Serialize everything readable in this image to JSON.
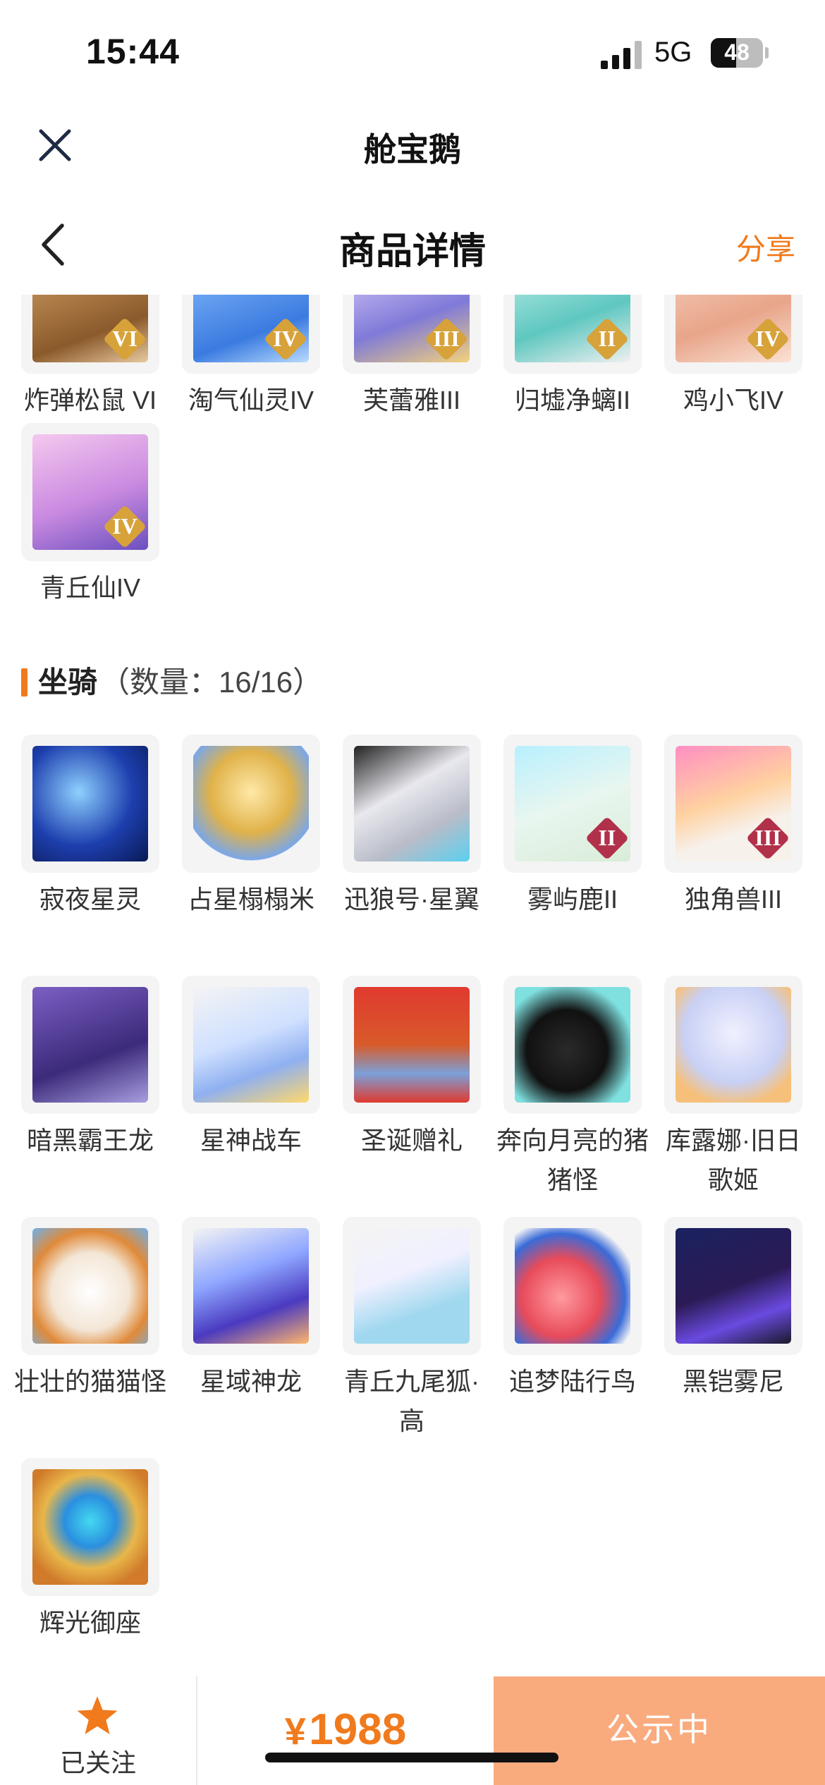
{
  "status_bar": {
    "time": "15:44",
    "network": "5G",
    "battery": 48
  },
  "header": {
    "app_title": "舱宝鹅",
    "page_title": "商品详情",
    "share_label": "分享"
  },
  "pets_partial": {
    "items": [
      {
        "name": "炸弹松鼠 VI",
        "rank": "VI"
      },
      {
        "name": "淘气仙灵IV",
        "rank": "IV"
      },
      {
        "name": "芙蕾雅III",
        "rank": "III"
      },
      {
        "name": "归墟净螭II",
        "rank": "II"
      },
      {
        "name": "鸡小飞IV",
        "rank": "IV"
      },
      {
        "name": "青丘仙IV",
        "rank": "IV"
      }
    ]
  },
  "mounts": {
    "title": "坐骑",
    "count": "（数量：16/16）",
    "items": [
      {
        "name": "寂夜星灵",
        "rank": ""
      },
      {
        "name": "占星榻榻米",
        "rank": ""
      },
      {
        "name": "迅狼号·星翼",
        "rank": ""
      },
      {
        "name": "雾屿鹿II",
        "rank": "II"
      },
      {
        "name": "独角兽III",
        "rank": "III"
      },
      {
        "name": "暗黑霸王龙",
        "rank": ""
      },
      {
        "name": "星神战车",
        "rank": ""
      },
      {
        "name": "圣诞赠礼",
        "rank": ""
      },
      {
        "name": "奔向月亮的猪猪怪",
        "rank": ""
      },
      {
        "name": "库露娜·旧日歌姬",
        "rank": ""
      },
      {
        "name": "壮壮的猫猫怪",
        "rank": ""
      },
      {
        "name": "星域神龙",
        "rank": ""
      },
      {
        "name": "青丘九尾狐·高",
        "rank": ""
      },
      {
        "name": "追梦陆行鸟",
        "rank": ""
      },
      {
        "name": "黑铠雾尼",
        "rank": ""
      },
      {
        "name": "辉光御座",
        "rank": ""
      }
    ]
  },
  "bottom_bar": {
    "follow_label": "已关注",
    "currency": "¥",
    "price": "1988",
    "status_label": "公示中"
  },
  "colors": {
    "accent": "#f07a1c",
    "status_button": "#f9ab7e"
  },
  "icons": [
    "signal-icon",
    "battery-icon",
    "close-icon",
    "back-chevron-icon",
    "star-icon",
    "rank-badge-icon"
  ]
}
